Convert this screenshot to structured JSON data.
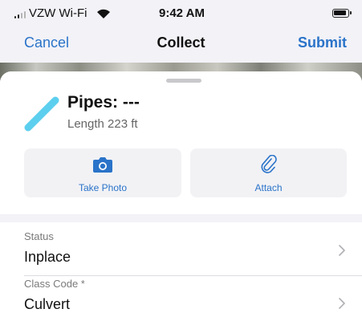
{
  "status_bar": {
    "carrier": "VZW Wi-Fi",
    "time": "9:42 AM",
    "signal_bars_filled": 2,
    "signal_bars_total": 4,
    "battery_level": 0.85
  },
  "nav": {
    "cancel_label": "Cancel",
    "title": "Collect",
    "submit_label": "Submit"
  },
  "feature": {
    "title": "Pipes: ---",
    "subtitle": "Length 223 ft",
    "glyph_color": "#5ccfee"
  },
  "actions": {
    "take_photo": {
      "label": "Take Photo",
      "icon": "camera-icon"
    },
    "attach": {
      "label": "Attach",
      "icon": "paperclip-icon"
    }
  },
  "form": {
    "fields": [
      {
        "label": "Status",
        "value": "Inplace"
      },
      {
        "label": "Class Code *",
        "value": "Culvert"
      }
    ]
  },
  "colors": {
    "accent": "#2a73c9",
    "background": "#f2f2f7",
    "sheet": "#ffffff"
  }
}
